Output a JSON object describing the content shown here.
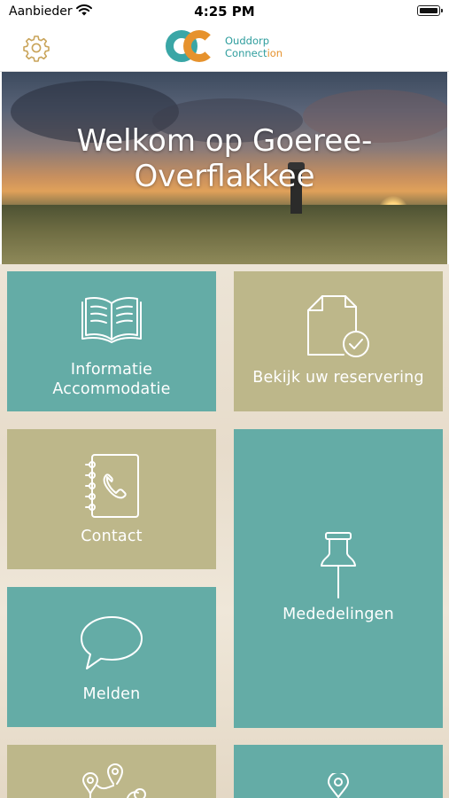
{
  "status_bar": {
    "carrier": "Aanbieder",
    "time": "4:25 PM"
  },
  "header": {
    "settings_icon": "gear-icon",
    "logo": {
      "monogram": "OC",
      "line1": "Ouddorp",
      "line2_main": "Connect",
      "line2_accent": "ion"
    }
  },
  "hero": {
    "title_line1": "Welkom op Goeree-",
    "title_line2": "Overflakkee"
  },
  "tiles": [
    {
      "label_line1": "Informatie",
      "label_line2": "Accommodatie",
      "icon": "book-icon",
      "color": "#64aca6"
    },
    {
      "label_line1": "Bekijk uw reservering",
      "icon": "document-check-icon",
      "color": "#bdb78a"
    },
    {
      "label_line1": "Contact",
      "icon": "phonebook-icon",
      "color": "#bdb78a"
    },
    {
      "label_line1": "Mededelingen",
      "icon": "pushpin-icon",
      "color": "#64aca6"
    },
    {
      "label_line1": "Melden",
      "icon": "speech-bubble-icon",
      "color": "#64aca6"
    },
    {
      "label_line1": "",
      "icon": "route-icon",
      "color": "#bdb78a"
    },
    {
      "label_line1": "",
      "icon": "location-pin-icon",
      "color": "#64aca6"
    }
  ],
  "colors": {
    "teal": "#64aca6",
    "olive": "#bdb78a",
    "logo_teal": "#3aa6a6",
    "logo_orange": "#e6922d"
  }
}
